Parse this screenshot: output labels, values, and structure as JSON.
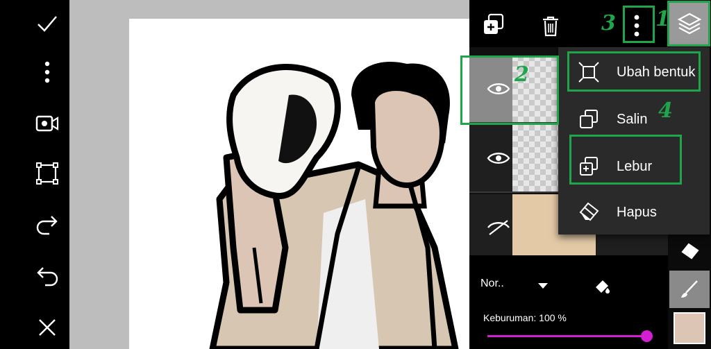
{
  "layers_panel": {
    "blend_mode": "Nor..",
    "opacity_label": "Keburuman: 100 %",
    "opacity_value": 1.0
  },
  "overflow_menu": {
    "items": [
      {
        "label": "Ubah bentuk",
        "icon": "transform-icon"
      },
      {
        "label": "Salin",
        "icon": "copy-icon"
      },
      {
        "label": "Lebur",
        "icon": "merge-icon"
      },
      {
        "label": "Hapus",
        "icon": "eraser-icon"
      }
    ]
  },
  "annotations": {
    "step1": "1",
    "step2": "2",
    "step3": "3",
    "step4": "4",
    "color": "#1fa64a"
  },
  "colors": {
    "accent_slider": "#d21fd2",
    "current_color": "#dcc5b4",
    "skin": "#dcc5b4",
    "jacket": "#d6c6b2"
  }
}
